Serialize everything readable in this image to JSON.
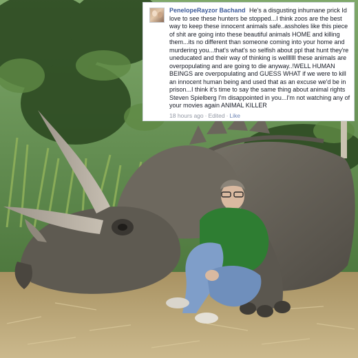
{
  "comment": {
    "author": "PenelopeRayzor Bachand",
    "text": "He's a disgusting inhumane prick Id love to see these hunters be stopped...I think zoos are the best way to keep these innocent animals safe..assholes like this piece of shit are going into these beautiful animals HOME and killing them...its no different than someone coming into your home and murdering you...that's what's so selfish about ppl that hunt they're uneducated and their way of thinking is welllllll these animals are overpopulating and are going to die anyway..!WELL HUMAN BEINGS are overpopulating and GUESS WHAT if we were to kill an innocent human being and used that as an excuse we'd be in prison...I think it's time to say the same thing about animal rights Steven Spielberg I'm disappointed in you...I'm not watching any of your movies again ANIMAL KILLER",
    "timestamp": "18 hours ago",
    "edited_label": "Edited",
    "like_label": "Like",
    "separator": "·"
  },
  "colors": {
    "author_link": "#3b5998",
    "meta_text": "#9197a3",
    "meta_link": "#6d84b4",
    "sky": "#9cc48a",
    "jungle_dark": "#2f4a22",
    "grass": "#7f9a4e",
    "ground": "#b8a47a",
    "dino_skin": "#6f6a60",
    "shirt": "#2e7d32",
    "jeans": "#7f9ec9"
  },
  "photo": {
    "subject": "man-sitting-against-triceratops"
  }
}
